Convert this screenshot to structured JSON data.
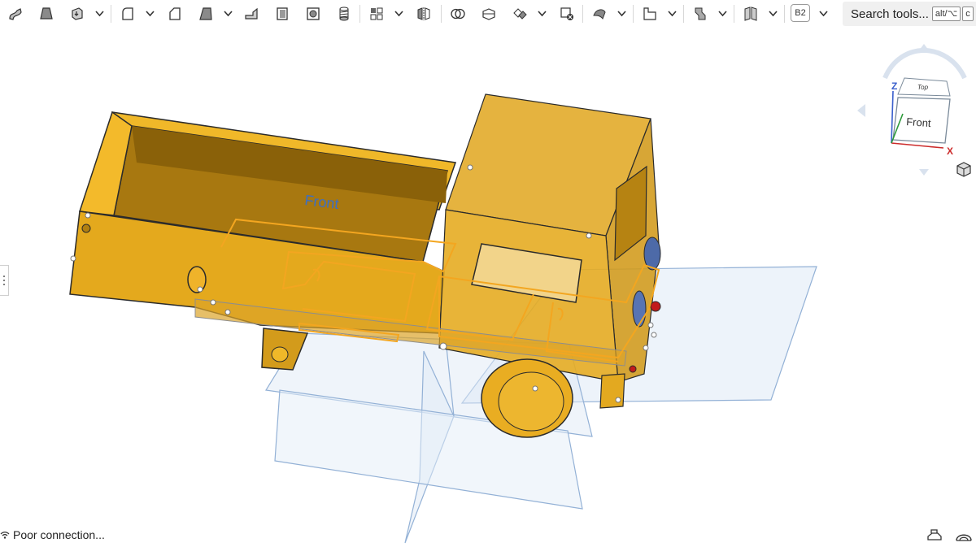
{
  "toolbar": {
    "b2_label": "B2",
    "search_placeholder": "Search tools...",
    "search_key1": "alt/⌥",
    "search_key2": "c"
  },
  "viewcube": {
    "face_front": "Front",
    "face_top": "Top",
    "axis_z": "Z",
    "axis_x": "X"
  },
  "viewport": {
    "plane_label": "Front"
  },
  "status": {
    "connection": "Poor connection..."
  },
  "colors": {
    "part": "#e0a51c",
    "part_dark": "#b57f0f",
    "plane": "#c8d8ec",
    "plane_edge": "#93b1d6",
    "sketch": "#f3a620"
  }
}
